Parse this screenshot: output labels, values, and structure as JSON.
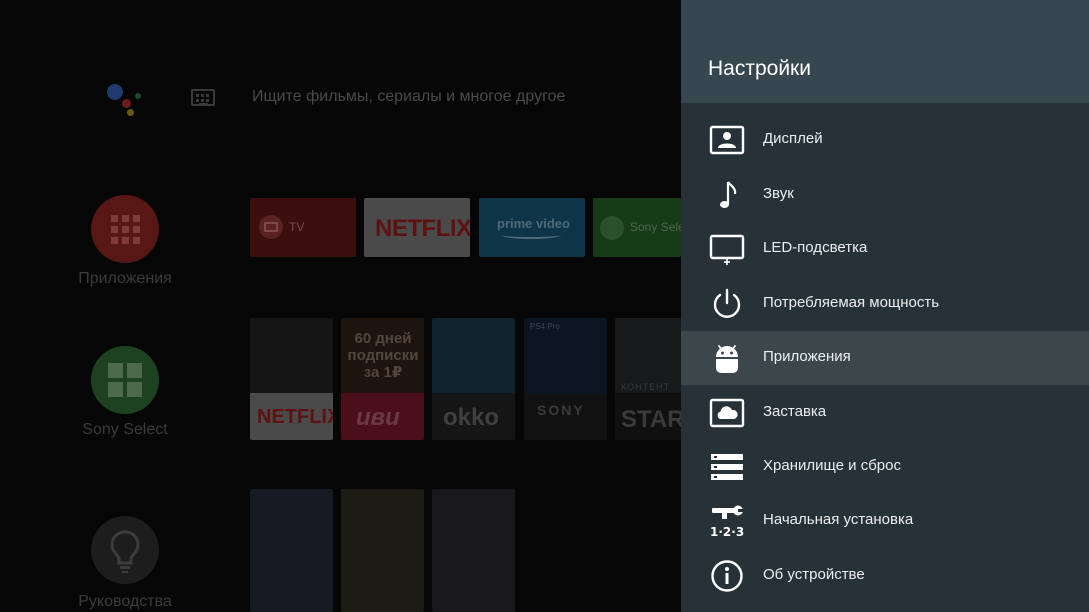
{
  "home": {
    "search_placeholder": "Ищите фильмы, сериалы и многое другое",
    "sidebar": [
      {
        "label": "Приложения",
        "color": "#e53935",
        "icon": "apps-grid-icon"
      },
      {
        "label": "Sony Select",
        "color": "#43a047",
        "icon": "sony-select-icon"
      },
      {
        "label": "Руководства",
        "color": "#424242",
        "icon": "lightbulb-icon"
      }
    ],
    "apps": [
      {
        "label": "TV",
        "color": "#b71c1c"
      },
      {
        "label": "NETFLIX",
        "color": "#f5f5f5"
      },
      {
        "label": "prime video",
        "color": "#00a8e1"
      },
      {
        "label": "Sony Select",
        "color": "#43a047"
      }
    ],
    "promo_cards": [
      {
        "label": "NETFLIX"
      },
      {
        "top_label": "60 дней подписки за 1₽",
        "label": "иви"
      },
      {
        "label": "okko"
      },
      {
        "top_label": "PS4 Pro",
        "label": "SONY"
      },
      {
        "top_label": "КОНТЕНТ",
        "label": "START"
      }
    ]
  },
  "settings": {
    "title": "Настройки",
    "items": [
      {
        "label": "Дисплей",
        "icon": "display-icon"
      },
      {
        "label": "Звук",
        "icon": "music-note-icon"
      },
      {
        "label": "LED-подсветка",
        "icon": "led-backlight-icon"
      },
      {
        "label": "Потребляемая мощность",
        "icon": "power-icon"
      },
      {
        "label": "Приложения",
        "icon": "android-icon",
        "selected": true
      },
      {
        "label": "Заставка",
        "icon": "screensaver-icon"
      },
      {
        "label": "Хранилище и сброс",
        "icon": "storage-icon"
      },
      {
        "label": "Начальная установка",
        "icon": "setup-icon"
      },
      {
        "label": "Об устройстве",
        "icon": "info-icon"
      }
    ]
  }
}
